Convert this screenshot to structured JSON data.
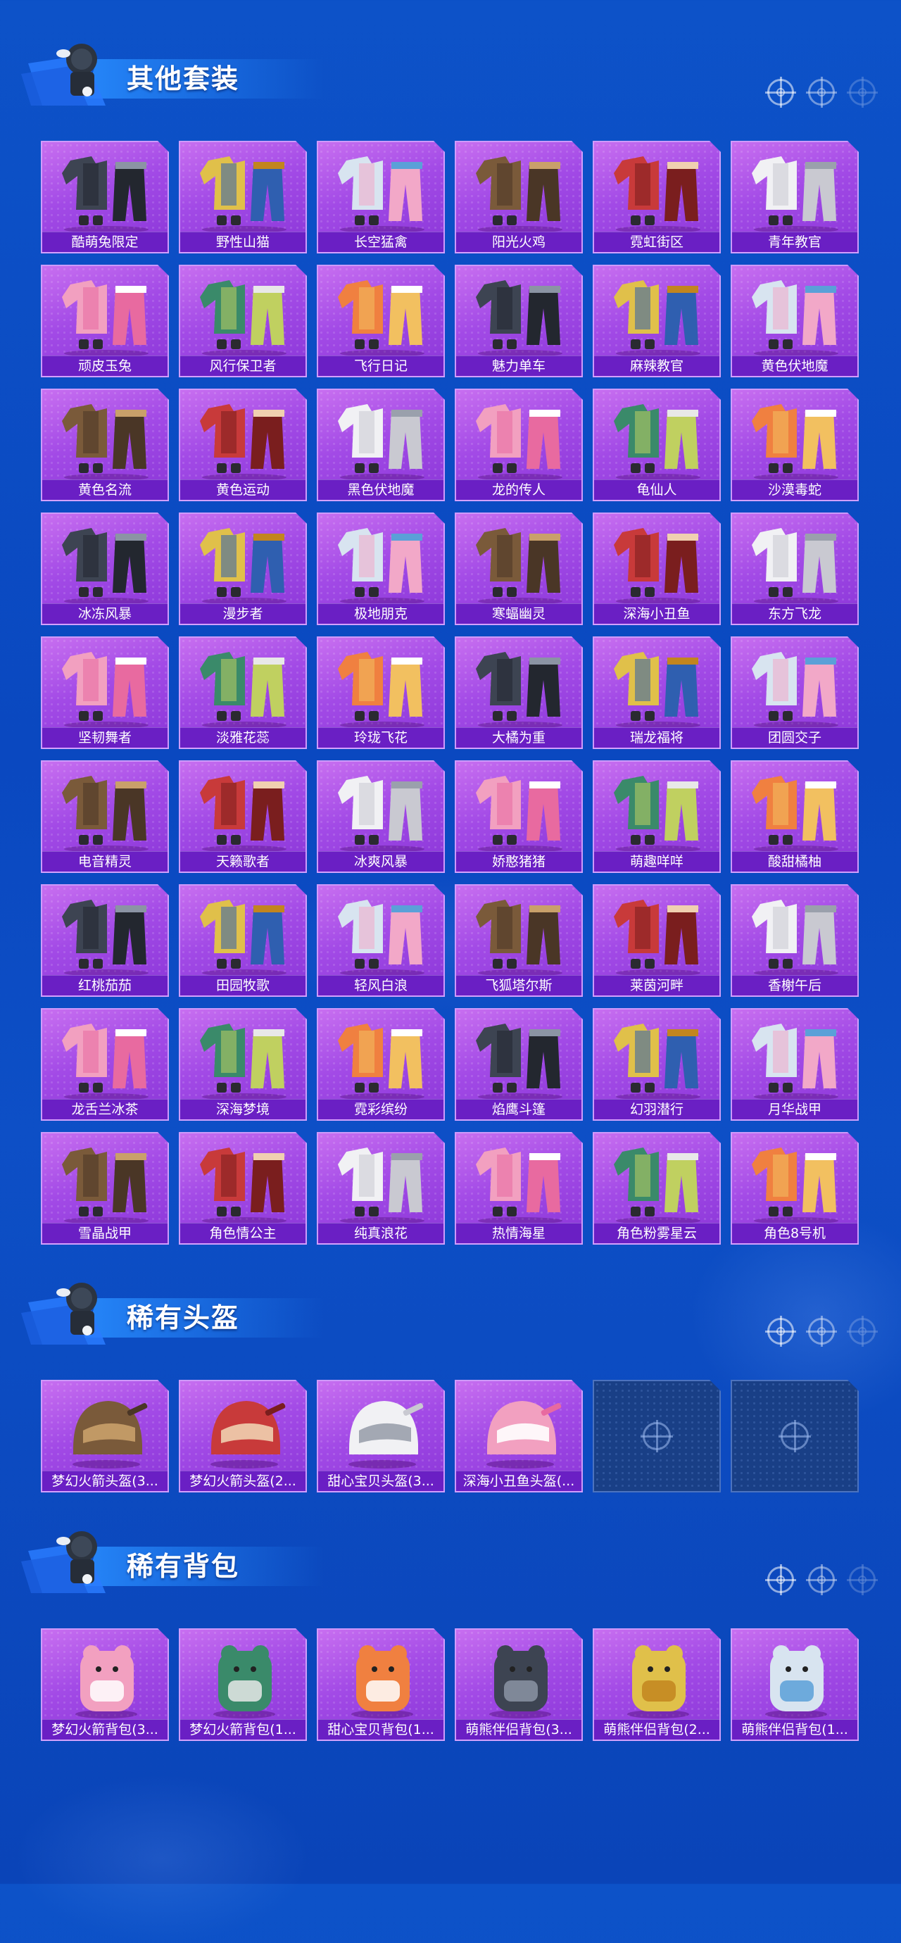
{
  "colors": {
    "background": "#0b4cc2",
    "card_top": "#c86ff0",
    "card_bottom": "#8a36d8",
    "label_bar": "#6a1fc4",
    "empty_slot": "#193f86"
  },
  "sections": [
    {
      "title": "其他套装",
      "items": [
        {
          "label": "酷萌兔限定",
          "icon": "outfit-icon"
        },
        {
          "label": "野性山猫",
          "icon": "outfit-icon"
        },
        {
          "label": "长空猛禽",
          "icon": "outfit-icon"
        },
        {
          "label": "阳光火鸡",
          "icon": "outfit-icon"
        },
        {
          "label": "霓虹街区",
          "icon": "outfit-icon"
        },
        {
          "label": "青年教官",
          "icon": "outfit-icon"
        },
        {
          "label": "顽皮玉兔",
          "icon": "outfit-icon"
        },
        {
          "label": "风行保卫者",
          "icon": "outfit-icon"
        },
        {
          "label": "飞行日记",
          "icon": "outfit-icon"
        },
        {
          "label": "魅力单车",
          "icon": "outfit-icon"
        },
        {
          "label": "麻辣教官",
          "icon": "outfit-icon"
        },
        {
          "label": "黄色伏地魔",
          "icon": "outfit-icon"
        },
        {
          "label": "黄色名流",
          "icon": "outfit-icon"
        },
        {
          "label": "黄色运动",
          "icon": "outfit-icon"
        },
        {
          "label": "黑色伏地魔",
          "icon": "outfit-icon"
        },
        {
          "label": "龙的传人",
          "icon": "outfit-icon"
        },
        {
          "label": "龟仙人",
          "icon": "outfit-icon"
        },
        {
          "label": "沙漠毒蛇",
          "icon": "outfit-icon"
        },
        {
          "label": "冰冻风暴",
          "icon": "outfit-icon"
        },
        {
          "label": "漫步者",
          "icon": "outfit-icon"
        },
        {
          "label": "极地朋克",
          "icon": "outfit-icon"
        },
        {
          "label": "寒蝠幽灵",
          "icon": "outfit-icon"
        },
        {
          "label": "深海小丑鱼",
          "icon": "outfit-icon"
        },
        {
          "label": "东方飞龙",
          "icon": "outfit-icon"
        },
        {
          "label": "坚韧舞者",
          "icon": "outfit-icon"
        },
        {
          "label": "淡雅花蕊",
          "icon": "outfit-icon"
        },
        {
          "label": "玲珑飞花",
          "icon": "outfit-icon"
        },
        {
          "label": "大橘为重",
          "icon": "outfit-icon"
        },
        {
          "label": "瑞龙福将",
          "icon": "outfit-icon"
        },
        {
          "label": "团圆交子",
          "icon": "outfit-icon"
        },
        {
          "label": "电音精灵",
          "icon": "outfit-icon"
        },
        {
          "label": "天籁歌者",
          "icon": "outfit-icon"
        },
        {
          "label": "冰爽风暴",
          "icon": "outfit-icon"
        },
        {
          "label": "娇憨猪猪",
          "icon": "outfit-icon"
        },
        {
          "label": "萌趣咩咩",
          "icon": "outfit-icon"
        },
        {
          "label": "酸甜橘柚",
          "icon": "outfit-icon"
        },
        {
          "label": "红桃茄茄",
          "icon": "outfit-icon"
        },
        {
          "label": "田园牧歌",
          "icon": "outfit-icon"
        },
        {
          "label": "轻风白浪",
          "icon": "outfit-icon"
        },
        {
          "label": "飞狐塔尔斯",
          "icon": "outfit-icon"
        },
        {
          "label": "莱茵河畔",
          "icon": "outfit-icon"
        },
        {
          "label": "香榭午后",
          "icon": "outfit-icon"
        },
        {
          "label": "龙舌兰冰茶",
          "icon": "outfit-icon"
        },
        {
          "label": "深海梦境",
          "icon": "outfit-icon"
        },
        {
          "label": "霓彩缤纷",
          "icon": "outfit-icon"
        },
        {
          "label": "焰鹰斗篷",
          "icon": "outfit-icon"
        },
        {
          "label": "幻羽潜行",
          "icon": "outfit-icon"
        },
        {
          "label": "月华战甲",
          "icon": "outfit-icon"
        },
        {
          "label": "雪晶战甲",
          "icon": "outfit-icon"
        },
        {
          "label": "角色情公主",
          "icon": "outfit-icon"
        },
        {
          "label": "纯真浪花",
          "icon": "outfit-icon"
        },
        {
          "label": "热情海星",
          "icon": "outfit-icon"
        },
        {
          "label": "角色粉雾星云",
          "icon": "outfit-icon"
        },
        {
          "label": "角色8号机",
          "icon": "outfit-icon"
        }
      ]
    },
    {
      "title": "稀有头盔",
      "items": [
        {
          "label": "梦幻火箭头盔(3...",
          "icon": "helmet-icon"
        },
        {
          "label": "梦幻火箭头盔(2...",
          "icon": "helmet-icon"
        },
        {
          "label": "甜心宝贝头盔(3...",
          "icon": "helmet-icon"
        },
        {
          "label": "深海小丑鱼头盔(...",
          "icon": "helmet-icon"
        },
        {
          "label": "",
          "icon": "empty-slot-icon"
        },
        {
          "label": "",
          "icon": "empty-slot-icon"
        }
      ]
    },
    {
      "title": "稀有背包",
      "items": [
        {
          "label": "梦幻火箭背包(3...",
          "icon": "backpack-icon"
        },
        {
          "label": "梦幻火箭背包(1...",
          "icon": "backpack-icon"
        },
        {
          "label": "甜心宝贝背包(1...",
          "icon": "backpack-icon"
        },
        {
          "label": "萌熊伴侣背包(3...",
          "icon": "backpack-icon"
        },
        {
          "label": "萌熊伴侣背包(2...",
          "icon": "backpack-icon"
        },
        {
          "label": "萌熊伴侣背包(1...",
          "icon": "backpack-icon"
        }
      ]
    }
  ]
}
